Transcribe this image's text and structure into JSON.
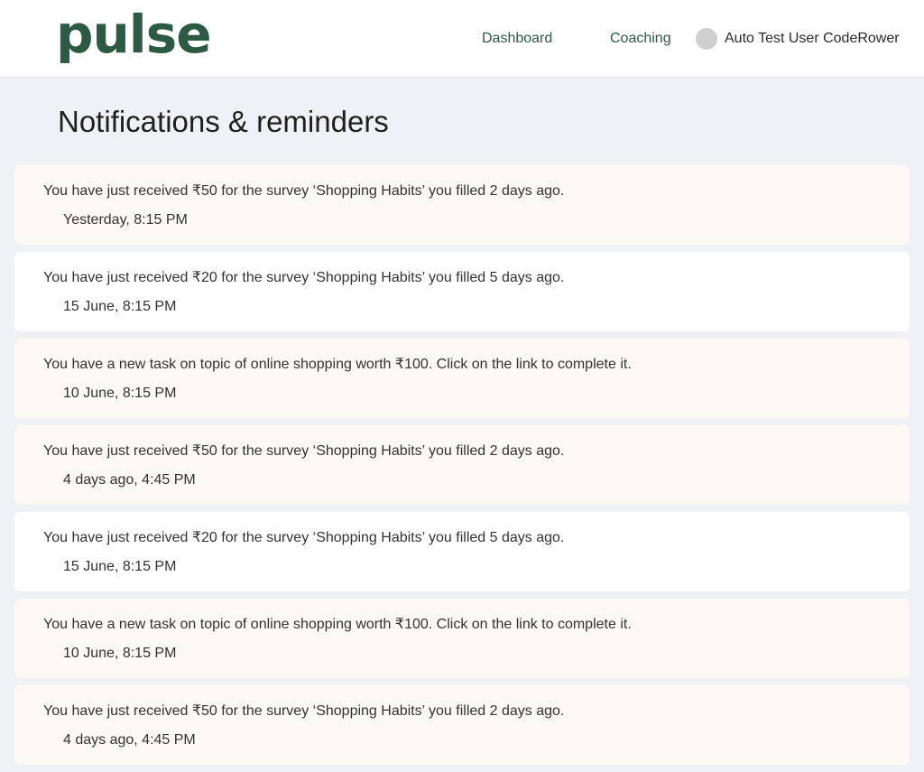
{
  "header": {
    "logo": "pulse",
    "nav": {
      "dashboard": "Dashboard",
      "coaching": "Coaching"
    },
    "user": {
      "name": "Auto Test User CodeRower",
      "avatar_color": "#cfcfcf"
    }
  },
  "page": {
    "title": "Notifications & reminders"
  },
  "colors": {
    "brand": "#2d5a45",
    "highlight_card": "#fcf8f3",
    "plain_card": "#ffffff",
    "background": "#f0f1f5"
  },
  "notifications": [
    {
      "message": "You have just received ₹50 for the survey ‘Shopping Habits’ you filled 2 days ago.",
      "time": "Yesterday, 8:15 PM",
      "style": "highlight"
    },
    {
      "message": "You have just received ₹20 for the survey ‘Shopping Habits’ you filled 5 days ago.",
      "time": "15 June, 8:15 PM",
      "style": "plain"
    },
    {
      "message": "You have a new task on topic of online shopping worth ₹100. Click on the link to complete it.",
      "time": "10 June, 8:15 PM",
      "style": "highlight"
    },
    {
      "message": "You have just received ₹50 for the survey ‘Shopping Habits’ you filled 2 days ago.",
      "time": "4 days ago, 4:45 PM",
      "style": "highlight"
    },
    {
      "message": "You have just received ₹20 for the survey ‘Shopping Habits’ you filled 5 days ago.",
      "time": "15 June, 8:15 PM",
      "style": "plain"
    },
    {
      "message": "You have a new task on topic of online shopping worth ₹100. Click on the link to complete it.",
      "time": "10 June, 8:15 PM",
      "style": "highlight"
    },
    {
      "message": "You have just received ₹50 for the survey ‘Shopping Habits’ you filled 2 days ago.",
      "time": "4 days ago, 4:45 PM",
      "style": "highlight"
    }
  ]
}
